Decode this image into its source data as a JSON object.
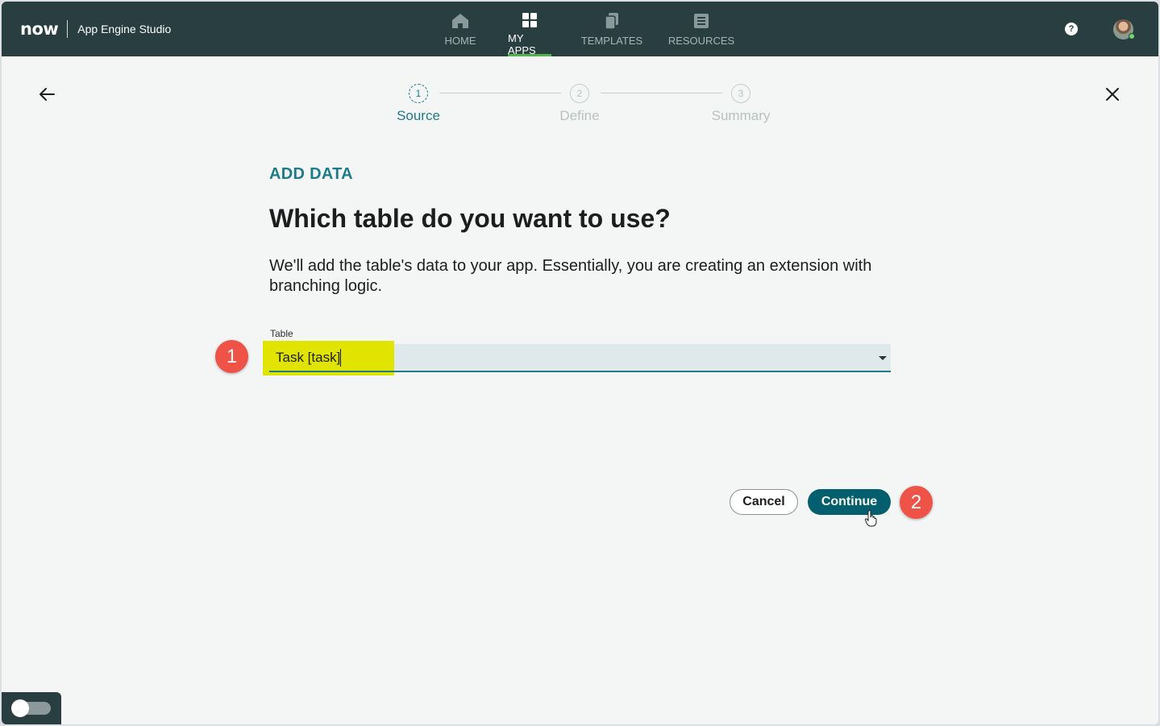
{
  "header": {
    "logo": "now",
    "app_name": "App Engine Studio",
    "nav": [
      {
        "label": "HOME",
        "icon": "home-icon",
        "active": false
      },
      {
        "label": "MY APPS",
        "icon": "grid-icon",
        "active": true
      },
      {
        "label": "TEMPLATES",
        "icon": "copy-icon",
        "active": false
      },
      {
        "label": "RESOURCES",
        "icon": "book-icon",
        "active": false
      }
    ],
    "help_label": "?"
  },
  "stepper": {
    "steps": [
      {
        "number": "1",
        "label": "Source",
        "active": true
      },
      {
        "number": "2",
        "label": "Define",
        "active": false
      },
      {
        "number": "3",
        "label": "Summary",
        "active": false
      }
    ]
  },
  "content": {
    "eyebrow": "ADD DATA",
    "heading": "Which table do you want to use?",
    "description": "We'll add the table's data to your app. Essentially, you are creating an extension with branching logic.",
    "table_field": {
      "label": "Table",
      "value": "Task [task]"
    }
  },
  "annotations": {
    "badge_1": "1",
    "badge_2": "2"
  },
  "buttons": {
    "cancel": "Cancel",
    "continue": "Continue"
  },
  "colors": {
    "header_bg": "#293e40",
    "accent": "#1f7b8a",
    "primary_button": "#035f6e",
    "highlight": "#e1e300",
    "badge": "#ef5347"
  }
}
